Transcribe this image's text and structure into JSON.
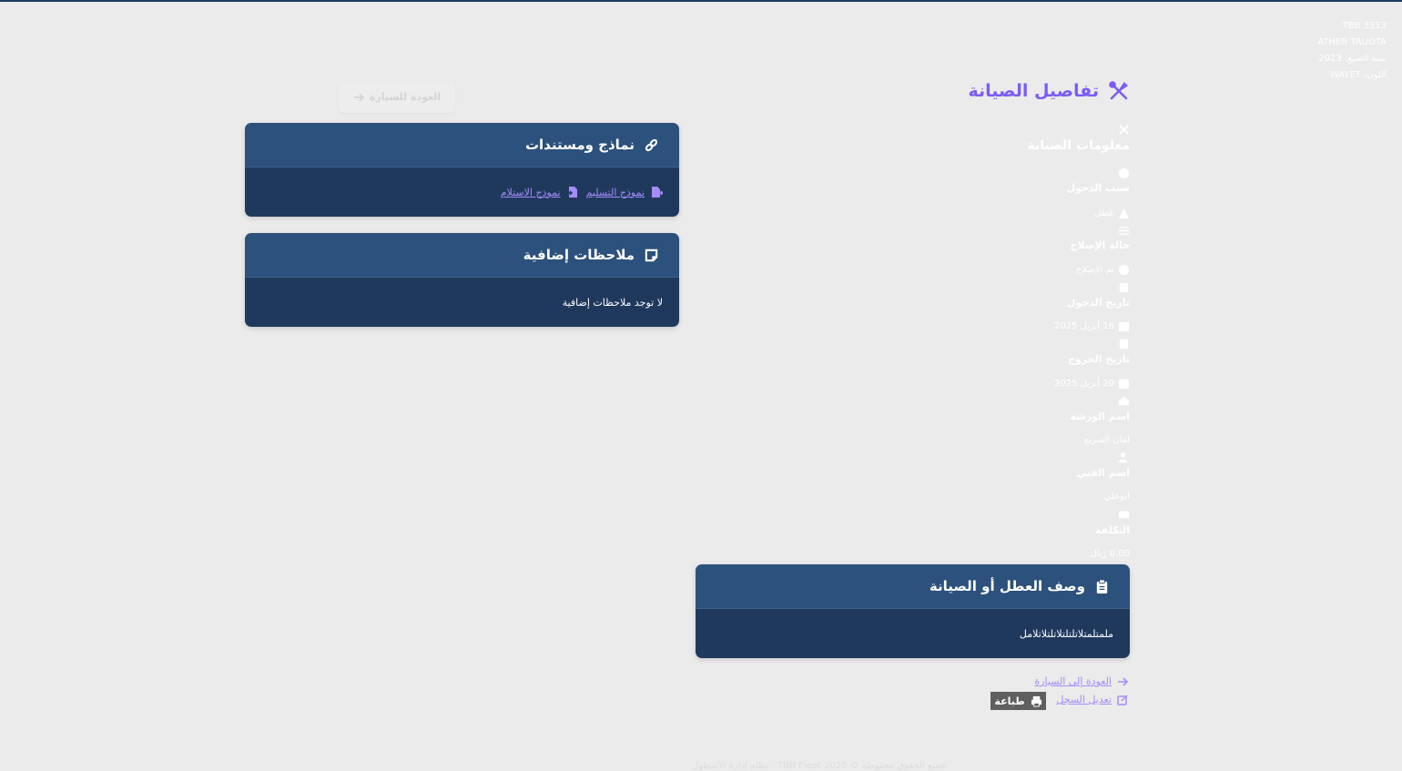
{
  "car": {
    "plate": "TBB 3313",
    "model": "ATHEB TAUOTA",
    "year_line": "سنة الصنع: 2023",
    "color_line": "اللون: WAYET"
  },
  "page": {
    "title": "تفاصيل الصيانة",
    "back_button": "العودة للسيارة"
  },
  "info": {
    "section_title": "معلومات الصيانة",
    "entry_reason_label": "سبب الدخول",
    "entry_reason_value": "عطل",
    "repair_status_label": "حالة الإصلاح",
    "repair_status_value": "تم الإصلاح",
    "entry_date_label": "تاريخ الدخول",
    "entry_date_value": "16 أبريل 2025",
    "exit_date_label": "تاريخ الخروج",
    "exit_date_value": "20 أبريل 2025",
    "workshop_label": "اسم الورشة",
    "workshop_value": "امان السريع",
    "technician_label": "اسم الفني",
    "technician_value": "ابوعلي",
    "cost_label": "التكلفة",
    "cost_value": "0.00 ريال"
  },
  "documents": {
    "title": "نماذج ومستندات",
    "handover_link": "نموذج التسليم",
    "receipt_link": "نموذج الاستلام"
  },
  "notes": {
    "title": "ملاحظات إضافية",
    "text": "لا توجد ملاحظات إضافية"
  },
  "description": {
    "title": "وصف العطل أو الصيانة",
    "text": "ملمتلمتلاتلتلتلاتلتلاتلامل"
  },
  "actions": {
    "back_link": "العودة إلى السيارة",
    "edit_link": "تعديل السجل",
    "print_button": "طباعة"
  },
  "footer": {
    "text": "جميع الحقوق محفوظة © 2025 TBB Fleet - نظام إدارة الأسطول"
  },
  "colors": {
    "accent": "#7c5cf2",
    "card_header": "#2c517c",
    "card_body": "#1f395d",
    "link": "#a78bfa"
  }
}
